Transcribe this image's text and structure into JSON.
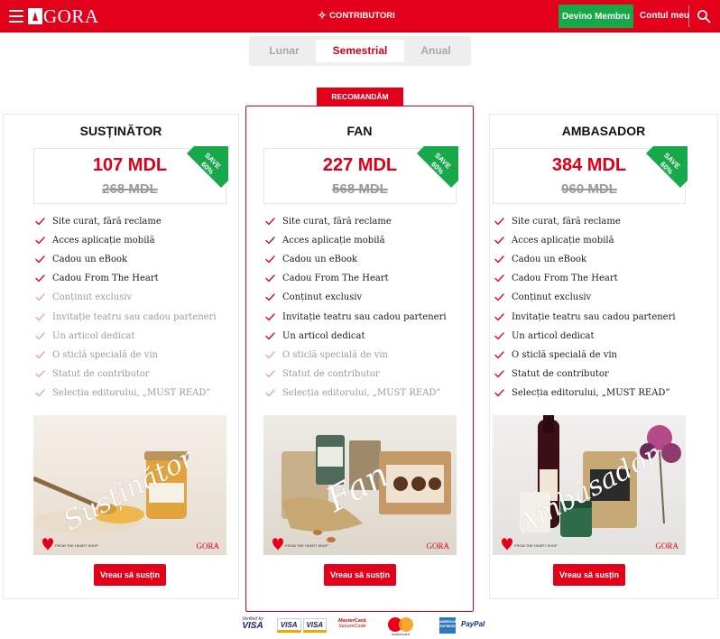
{
  "header": {
    "logo_text": "GORA",
    "contributors_label": "CONTRIBUTORI",
    "member_button": "Devino Membru",
    "account_link": "Contul meu",
    "brand_color": "#e3001b",
    "member_color": "#17a84a"
  },
  "period_tabs": [
    {
      "label": "Lunar",
      "active": false
    },
    {
      "label": "Semestrial",
      "active": true
    },
    {
      "label": "Anual",
      "active": false
    }
  ],
  "recommended_badge": "RECOMANDĂM",
  "plans": [
    {
      "name": "SUSȚINĂTOR",
      "price": "107 MDL",
      "old_price": "268 MDL",
      "save": [
        "SAVE",
        "60%"
      ],
      "features": [
        {
          "text": "Site curat, fără reclame",
          "included": true
        },
        {
          "text": "Acces aplicație mobilă",
          "included": true
        },
        {
          "text": "Cadou un eBook",
          "included": true
        },
        {
          "text": "Cadou From The Heart",
          "included": true
        },
        {
          "text": "Conținut exclusiv",
          "included": false
        },
        {
          "text": "Invitație teatru sau cadou parteneri",
          "included": false
        },
        {
          "text": "Un articol dedicat",
          "included": false
        },
        {
          "text": "O sticlă specială de vin",
          "included": false
        },
        {
          "text": "Statut de contributor",
          "included": false
        },
        {
          "text": "Selecția editorului, „MUST READ”",
          "included": false
        }
      ],
      "image_script": "Susținător",
      "image_brand_left": "FROM THE HEART SHOP",
      "image_brand_right": "GORA",
      "cta": "Vreau să susțin"
    },
    {
      "name": "FAN",
      "price": "227 MDL",
      "old_price": "568 MDL",
      "save": [
        "SAVE",
        "60%"
      ],
      "features": [
        {
          "text": "Site curat, fără reclame",
          "included": true
        },
        {
          "text": "Acces aplicație mobilă",
          "included": true
        },
        {
          "text": "Cadou un eBook",
          "included": true
        },
        {
          "text": "Cadou From The Heart",
          "included": true
        },
        {
          "text": "Conținut exclusiv",
          "included": true
        },
        {
          "text": "Invitație teatru sau cadou parteneri",
          "included": true
        },
        {
          "text": "Un articol dedicat",
          "included": true
        },
        {
          "text": "O sticlă specială de vin",
          "included": false
        },
        {
          "text": "Statut de contributor",
          "included": false
        },
        {
          "text": "Selecția editorului, „MUST READ”",
          "included": false
        }
      ],
      "image_script": "Fan",
      "image_brand_left": "FROM THE HEART SHOP",
      "image_brand_right": "GORA",
      "cta": "Vreau să susțin"
    },
    {
      "name": "AMBASADOR",
      "price": "384 MDL",
      "old_price": "960 MDL",
      "save": [
        "SAVE",
        "60%"
      ],
      "features": [
        {
          "text": "Site curat, fără reclame",
          "included": true
        },
        {
          "text": "Acces aplicație mobilă",
          "included": true
        },
        {
          "text": "Cadou un eBook",
          "included": true
        },
        {
          "text": "Cadou From The Heart",
          "included": true
        },
        {
          "text": "Conținut exclusiv",
          "included": true
        },
        {
          "text": "Invitație teatru sau cadou parteneri",
          "included": true
        },
        {
          "text": "Un articol dedicat",
          "included": true
        },
        {
          "text": "O sticlă specială de vin",
          "included": true
        },
        {
          "text": "Statut de contributor",
          "included": true
        },
        {
          "text": "Selecția editorului, „MUST READ”",
          "included": true
        }
      ],
      "image_script": "Ambasador",
      "image_brand_left": "FROM THE HEART SHOP",
      "image_brand_right": "GORA",
      "cta": "Vreau să susțin"
    }
  ],
  "payment_logos": {
    "verified_by": [
      "Verified by",
      "VISA"
    ],
    "visa": [
      "VISA",
      "VISA"
    ],
    "mastercard_sc": [
      "MasterCard.",
      "SecureCode"
    ],
    "mastercard": "mastercard",
    "amex": "AMERICAN EXPRESS",
    "paypal": "PayPal"
  }
}
